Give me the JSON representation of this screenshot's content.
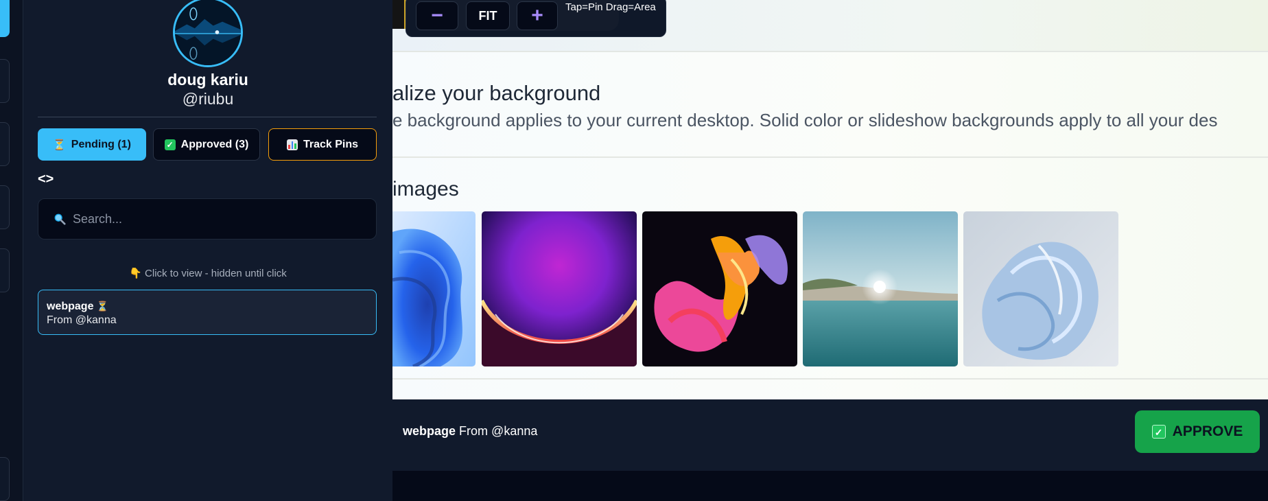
{
  "profile": {
    "name": "doug kariu",
    "handle": "@riubu"
  },
  "tabs": [
    {
      "label": "Pending (1)",
      "icon": "hourglass-icon"
    },
    {
      "label": "Approved (3)",
      "icon": "check-icon"
    },
    {
      "label": "Track Pins",
      "icon": "bar-chart-icon"
    }
  ],
  "code_toggle": "<>",
  "search": {
    "placeholder": "Search..."
  },
  "hint": "Click to view - hidden until click",
  "pending_items": [
    {
      "title": "webpage",
      "from": "From @kanna"
    }
  ],
  "zoom_controls": {
    "minus": "−",
    "fit": "FIT",
    "plus": "+",
    "hint": "Tap=Pin Drag=Area"
  },
  "preview": {
    "heading": "alize your background",
    "description": "e background applies to your current desktop. Solid color or slideshow backgrounds apply to all your des",
    "images_heading": "images"
  },
  "bottom": {
    "title": "webpage",
    "from": "From @kanna",
    "approve_label": "APPROVE"
  },
  "colors": {
    "accent": "#38bdf8",
    "track_border": "#f59e0b",
    "approve": "#16a34a",
    "panel_bg": "#111a2c"
  }
}
